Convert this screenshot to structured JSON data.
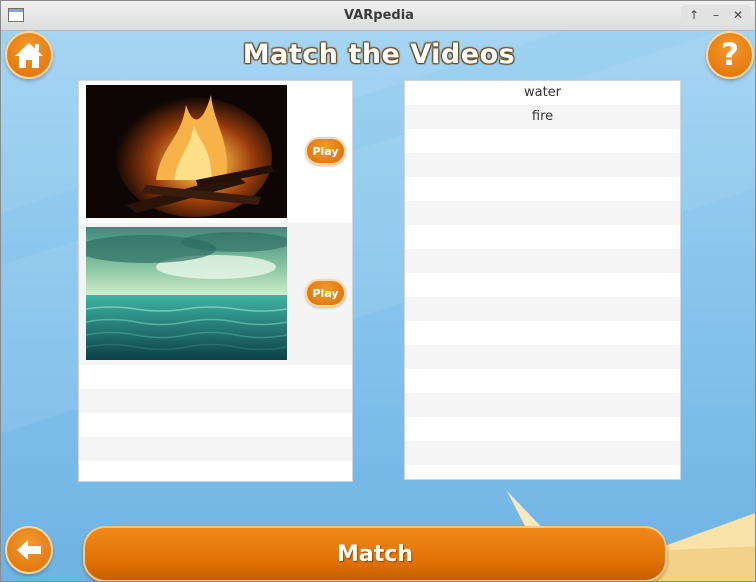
{
  "window": {
    "title": "VARpedia"
  },
  "header": {
    "heading": "Match the Videos"
  },
  "videos": [
    {
      "thumbnail": "campfire-at-night-image",
      "play_label": "Play"
    },
    {
      "thumbnail": "ocean-horizon-image",
      "play_label": "Play"
    }
  ],
  "words": [
    "water",
    "fire"
  ],
  "actions": {
    "match_label": "Match"
  },
  "icons": {
    "home": "home-icon",
    "help": "question-mark-icon",
    "back": "back-arrow-icon"
  },
  "colors": {
    "accent": "#e57906",
    "background": "#8fc9ee"
  }
}
